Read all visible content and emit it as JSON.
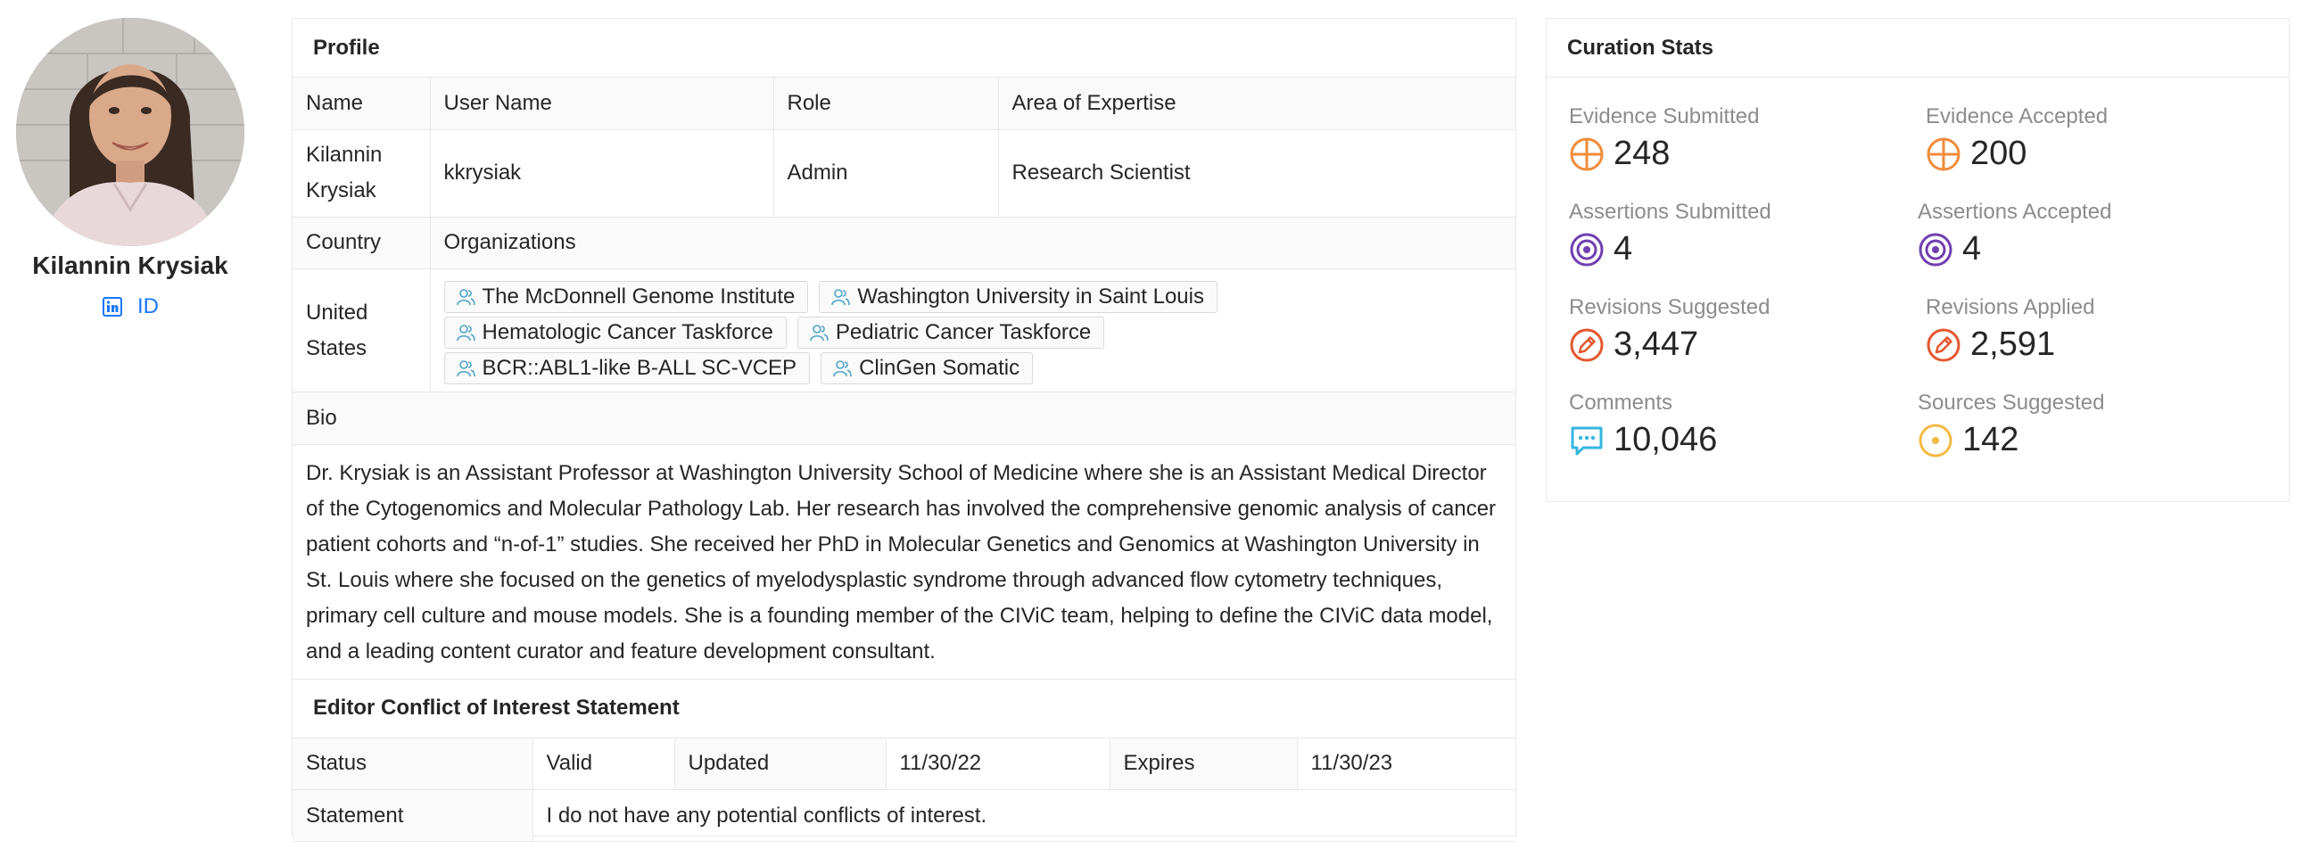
{
  "user": {
    "name": "Kilannin Krysiak",
    "id_link": "ID"
  },
  "profile": {
    "title": "Profile",
    "headers": {
      "name": "Name",
      "username": "User Name",
      "role": "Role",
      "expertise": "Area of Expertise"
    },
    "values": {
      "name": "Kilannin Krysiak",
      "username": "kkrysiak",
      "role": "Admin",
      "expertise": "Research Scientist"
    },
    "country_label": "Country",
    "orgs_label": "Organizations",
    "country": "United States",
    "organizations": [
      "The McDonnell Genome Institute",
      "Washington University in Saint Louis",
      "Hematologic Cancer Taskforce",
      "Pediatric Cancer Taskforce",
      "BCR::ABL1-like B-ALL SC-VCEP",
      "ClinGen Somatic"
    ],
    "bio_label": "Bio",
    "bio": "Dr. Krysiak is an Assistant Professor at Washington University School of Medicine where she is an Assistant Medical Director of the Cytogenomics and Molecular Pathology Lab. Her research has involved the comprehensive genomic analysis of cancer patient cohorts and “n-of-1” studies. She received her PhD in Molecular Genetics and Genomics at Washington University in St. Louis where she focused on the genetics of myelodysplastic syndrome through advanced flow cytometry techniques, primary cell culture and mouse models. She is a founding member of the CIViC team, helping to define the CIViC data model, and a leading content curator and feature development consultant."
  },
  "coi": {
    "title": "Editor Conflict of Interest Statement",
    "status_label": "Status",
    "status": "Valid",
    "updated_label": "Updated",
    "updated": "11/30/22",
    "expires_label": "Expires",
    "expires": "11/30/23",
    "statement_label": "Statement",
    "statement": "I do not have any potential conflicts of interest."
  },
  "stats": {
    "title": "Curation Stats",
    "evidence_submitted": {
      "label": "Evidence Submitted",
      "value": "248"
    },
    "evidence_accepted": {
      "label": "Evidence Accepted",
      "value": "200"
    },
    "assertions_submitted": {
      "label": "Assertions Submitted",
      "value": "4"
    },
    "assertions_accepted": {
      "label": "Assertions Accepted",
      "value": "4"
    },
    "revisions_suggested": {
      "label": "Revisions Suggested",
      "value": "3,447"
    },
    "revisions_applied": {
      "label": "Revisions Applied",
      "value": "2,591"
    },
    "comments": {
      "label": "Comments",
      "value": "10,046"
    },
    "sources_suggested": {
      "label": "Sources Suggested",
      "value": "142"
    }
  },
  "colors": {
    "link": "#1677ff",
    "evidence": "#f08c3a",
    "assertion": "#6f3fb0",
    "revision": "#e4572e",
    "comment": "#36b5e0",
    "source": "#f5b942",
    "org_icon": "#4aa3c9"
  }
}
